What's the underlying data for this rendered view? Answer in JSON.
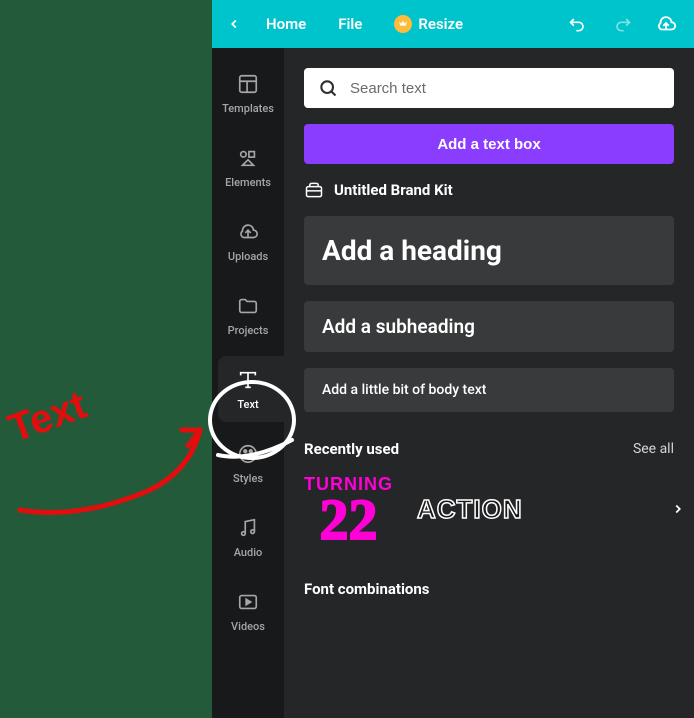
{
  "topbar": {
    "home": "Home",
    "file": "File",
    "resize": "Resize"
  },
  "sidebar": {
    "items": [
      {
        "label": "Templates"
      },
      {
        "label": "Elements"
      },
      {
        "label": "Uploads"
      },
      {
        "label": "Projects"
      },
      {
        "label": "Text"
      },
      {
        "label": "Styles"
      },
      {
        "label": "Audio"
      },
      {
        "label": "Videos"
      }
    ]
  },
  "panel": {
    "search_placeholder": "Search text",
    "add_text_box": "Add a text box",
    "brand_kit": "Untitled Brand Kit",
    "heading": "Add a heading",
    "subheading": "Add a subheading",
    "body": "Add a little bit of body text",
    "recently_used": "Recently used",
    "see_all": "See all",
    "templates": {
      "turning": "TURNING",
      "number": "22",
      "action": "ACTION"
    },
    "font_combinations": "Font combinations"
  },
  "annotation": {
    "label": "Text"
  },
  "colors": {
    "accent": "#8b3dff",
    "topbar": "#00c4cc",
    "annotation_bg": "#235b3a",
    "annotation_ink": "#e30d0d"
  }
}
